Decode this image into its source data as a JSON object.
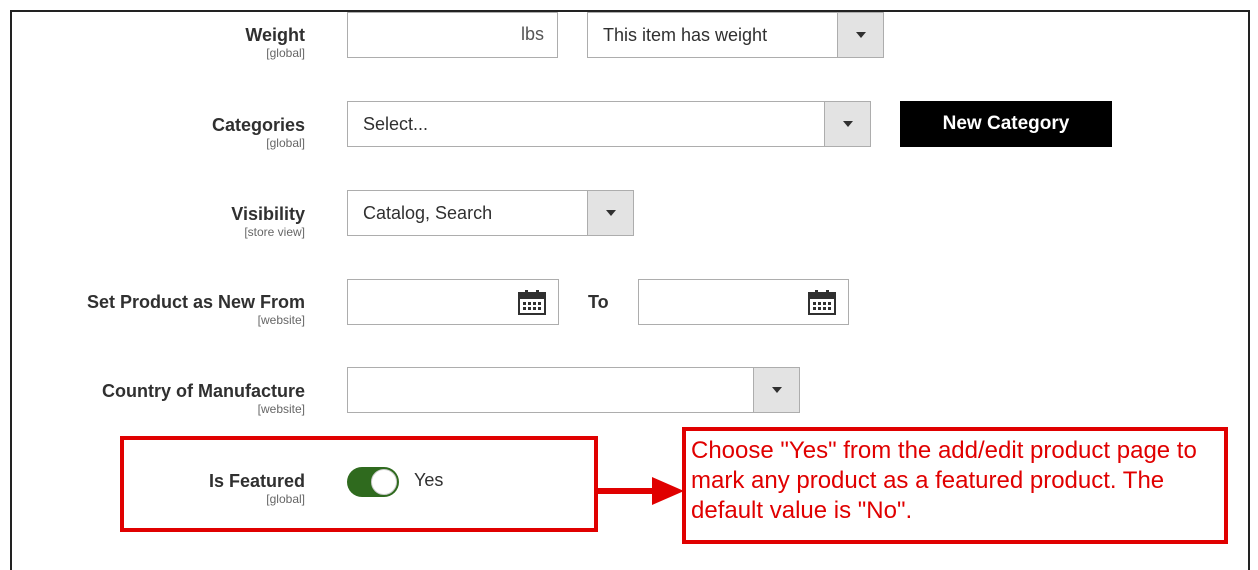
{
  "weight": {
    "label": "Weight",
    "scope": "[global]",
    "value": "",
    "unit": "lbs",
    "select_value": "This item has weight"
  },
  "categories": {
    "label": "Categories",
    "scope": "[global]",
    "select_value": "Select...",
    "new_category_button": "New Category"
  },
  "visibility": {
    "label": "Visibility",
    "scope": "[store view]",
    "select_value": "Catalog, Search"
  },
  "new_from": {
    "label": "Set Product as New From",
    "scope": "[website]",
    "from_value": "",
    "to_label": "To",
    "to_value": ""
  },
  "country": {
    "label": "Country of Manufacture",
    "scope": "[website]",
    "select_value": ""
  },
  "is_featured": {
    "label": "Is Featured",
    "scope": "[global]",
    "toggle_state": "on",
    "toggle_label": "Yes"
  },
  "annotation": {
    "text": "Choose \"Yes\" from the add/edit product page to mark any product as a featured product. The default value is \"No\".",
    "color": "#e00000"
  },
  "colors": {
    "toggle_on": "#2f6a1e",
    "button_dark": "#000000",
    "select_button": "#e3e3e3"
  }
}
